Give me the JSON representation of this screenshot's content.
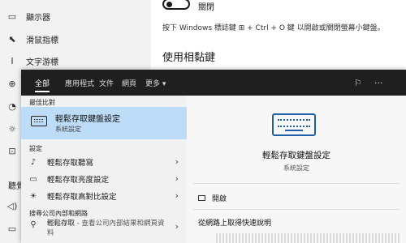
{
  "settings": {
    "sidebar": [
      {
        "icon": "monitor-icon",
        "glyph": "▭",
        "label": "顯示器"
      },
      {
        "icon": "mouse-pointer-icon",
        "glyph": "⬉",
        "label": "滑鼠指標"
      },
      {
        "icon": "text-cursor-icon",
        "glyph": "Ι",
        "label": "文字游標"
      },
      {
        "icon": "magnifier-icon",
        "glyph": "⊕"
      },
      {
        "icon": "color-filter-icon",
        "glyph": "◔"
      },
      {
        "icon": "high-contrast-icon",
        "glyph": "☼"
      },
      {
        "icon": "narrator-icon",
        "glyph": "⊡"
      },
      {
        "label": "聽覺"
      },
      {
        "icon": "audio-icon",
        "glyph": "◁)"
      },
      {
        "icon": "captions-icon",
        "glyph": "▭"
      }
    ],
    "toggle_label": "關閉",
    "toggle_desc": "按下 Windows 標誌鍵 ⊞ + Ctrl + O 鍵 以開啟或關閉螢幕小鍵盤。",
    "section_heading": "使用相黏鍵"
  },
  "search": {
    "tabs": [
      "全部",
      "應用程式",
      "文件",
      "網頁",
      "更多 ▾"
    ],
    "top_icons": [
      {
        "name": "feedback-icon",
        "glyph": "⚐"
      },
      {
        "name": "more-options-icon",
        "glyph": "···"
      }
    ],
    "best_match_label": "最佳比對",
    "best_match": {
      "title": "輕鬆存取鍵盤設定",
      "subtitle": "系統設定",
      "icon": "keyboard-icon"
    },
    "settings_label": "設定",
    "settings_items": [
      {
        "label": "輕鬆存取聽寫",
        "icon": "microphone-icon",
        "glyph": "🎙"
      },
      {
        "label": "輕鬆存取亮度設定",
        "icon": "monitor-icon",
        "glyph": "▭"
      },
      {
        "label": "輕鬆存取高對比設定",
        "icon": "brightness-icon",
        "glyph": "☀"
      }
    ],
    "web_label": "搜尋公司內部和網路",
    "web_item": {
      "title": "輕鬆存取",
      "rest": " - 查看公司內部結果和網頁資",
      "more": "料",
      "icon": "search-icon",
      "glyph": "⚲"
    },
    "preview": {
      "title": "輕鬆存取鍵盤設定",
      "subtitle": "系統設定",
      "open_label": "開啟",
      "web_heading": "從網路上取得快速說明"
    }
  },
  "colors": {
    "accent": "#1f5fa8",
    "selection": "#bcdcf7",
    "menu_bar": "#1f1f1f"
  }
}
